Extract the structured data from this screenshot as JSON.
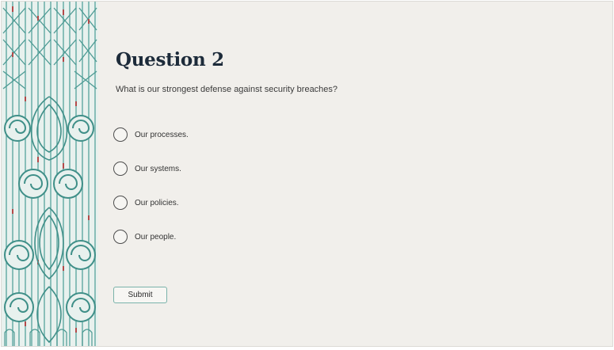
{
  "quiz": {
    "title": "Question 2",
    "prompt": "What is our strongest defense against security breaches?",
    "options": [
      {
        "label": "Our processes."
      },
      {
        "label": "Our systems."
      },
      {
        "label": "Our policies."
      },
      {
        "label": "Our people."
      }
    ],
    "submit_label": "Submit"
  },
  "theme": {
    "background": "#f1efeb",
    "title_color": "#1d2b3a",
    "pattern_teal": "#5fa9a2",
    "pattern_red": "#b34a4a",
    "button_border": "#7ab3aa"
  },
  "decoration": {
    "side_panel": "kowhaiwhai-pattern"
  }
}
